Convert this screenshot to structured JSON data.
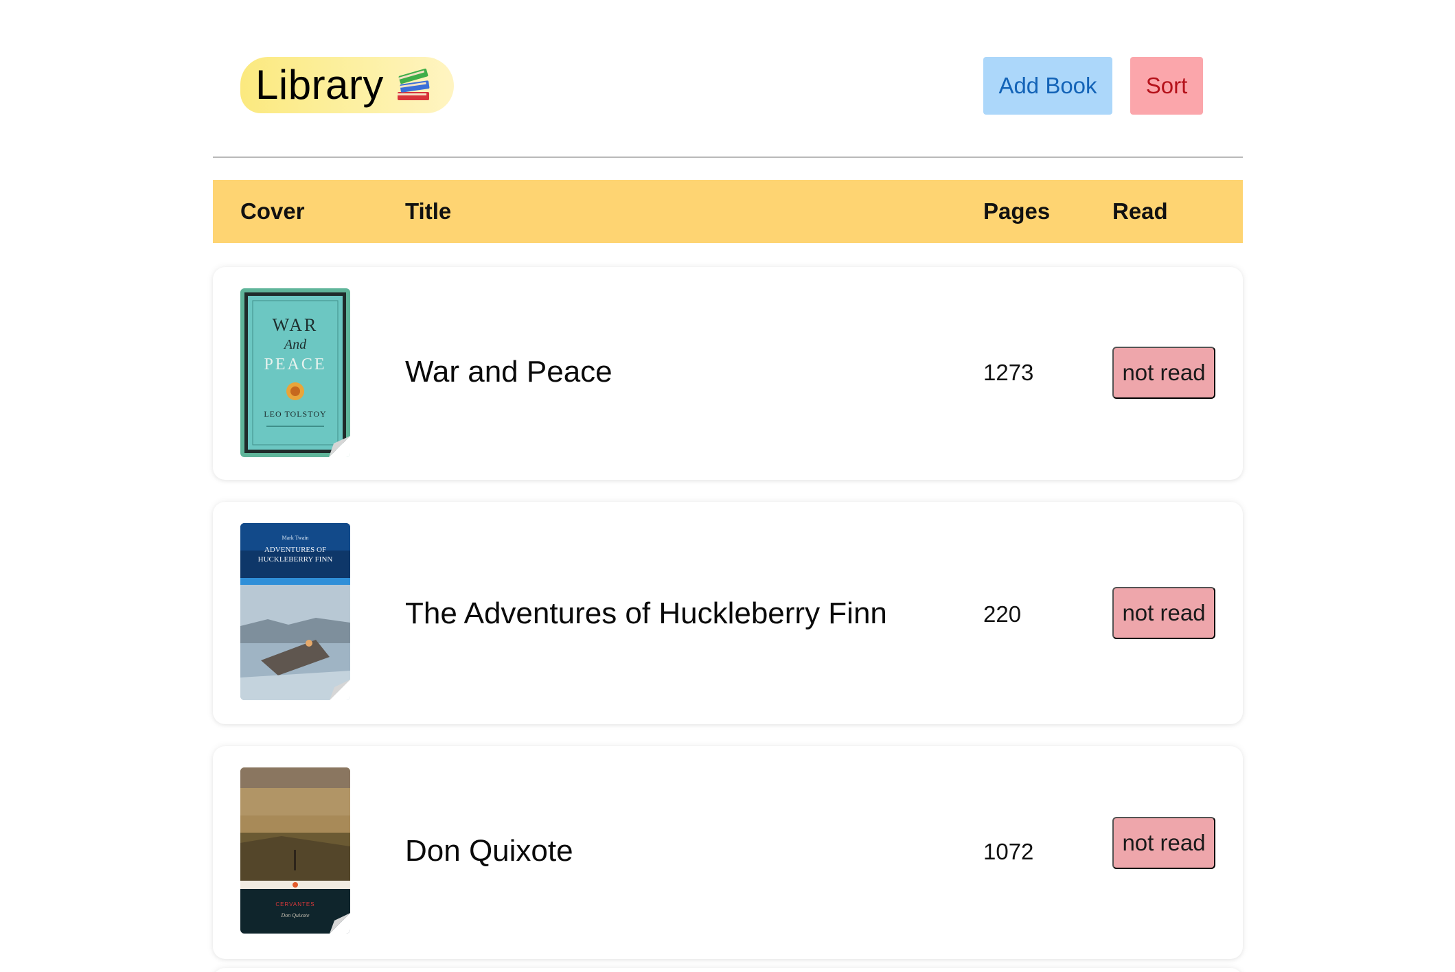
{
  "header": {
    "title": "Library",
    "title_icon": "books-icon",
    "add_label": "Add Book",
    "sort_label": "Sort"
  },
  "table": {
    "columns": [
      "Cover",
      "Title",
      "Pages",
      "Read"
    ]
  },
  "books": [
    {
      "title": "War and Peace",
      "pages": "1273",
      "status": "not read",
      "cover": {
        "line1": "WAR",
        "line2": "And",
        "line3": "PEACE",
        "author": "LEO TOLSTOY"
      }
    },
    {
      "title": "The Adventures of Huckleberry Finn",
      "pages": "220",
      "status": "not read",
      "cover": {
        "author": "Mark Twain",
        "line1": "ADVENTURES OF",
        "line2": "HUCKLEBERRY FINN"
      }
    },
    {
      "title": "Don Quixote",
      "pages": "1072",
      "status": "not read",
      "cover": {
        "author": "CERVANTES",
        "line1": "Don Quixote"
      }
    }
  ],
  "colors": {
    "header_bg": "#fed472",
    "add_button_bg": "#acd7fa",
    "sort_button_bg": "#fba6ab",
    "status_bg": "#eea6ab"
  }
}
